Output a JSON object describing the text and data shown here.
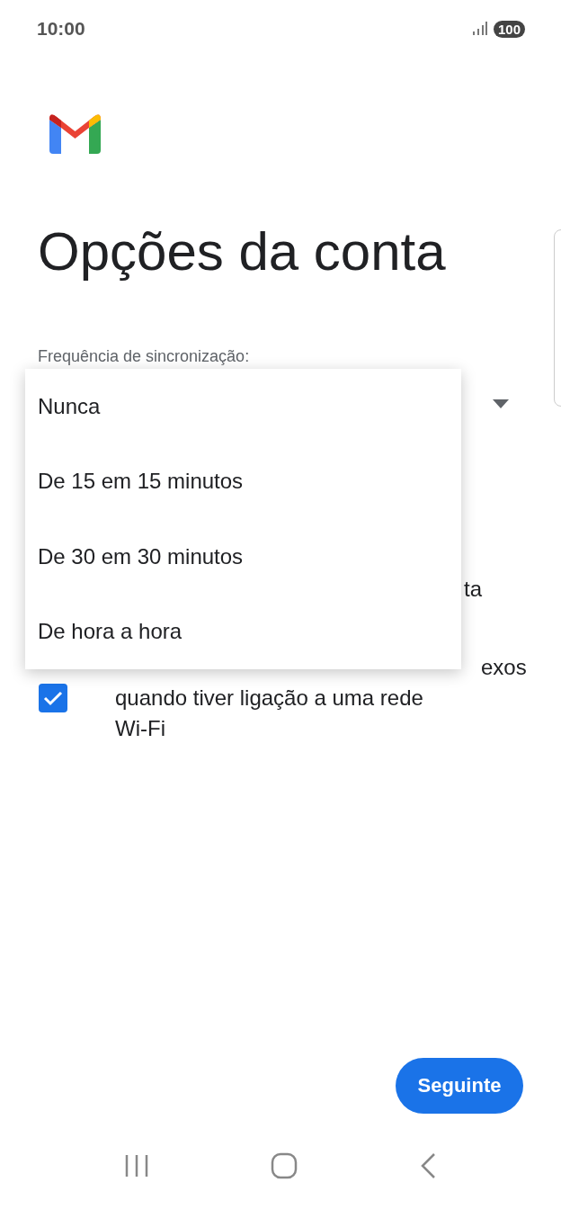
{
  "status_bar": {
    "time": "10:00",
    "battery": "100"
  },
  "title": "Opções da conta",
  "sync_frequency": {
    "label": "Frequência de sincronização:",
    "options": [
      {
        "label": "Nunca"
      },
      {
        "label": "De 15 em 15 minutos"
      },
      {
        "label": "De 30 em 30 minutos"
      },
      {
        "label": "De hora a hora"
      }
    ]
  },
  "covered_text": "ta",
  "attachments_option": {
    "covered_line_end": "exos",
    "label": "quando tiver ligação a uma rede Wi-Fi",
    "checked": true
  },
  "next_button": "Seguinte"
}
